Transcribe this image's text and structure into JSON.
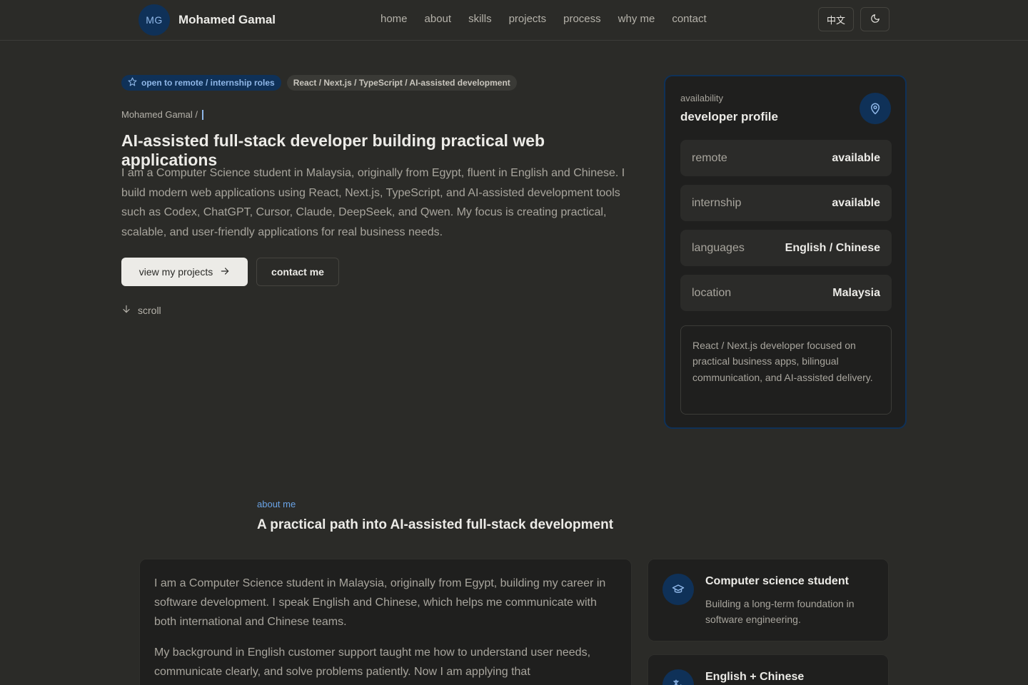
{
  "header": {
    "avatar_initials": "MG",
    "brand_name": "Mohamed Gamal",
    "nav": [
      "home",
      "about",
      "skills",
      "projects",
      "process",
      "why me",
      "contact"
    ],
    "lang_toggle": "中文",
    "theme_icon": "moon-icon"
  },
  "hero": {
    "badge_primary": "open to remote / internship roles",
    "badge_primary_icon": "star-icon",
    "badge_secondary": "React / Next.js / TypeScript / AI-assisted development",
    "breadcrumb": "Mohamed Gamal /",
    "title": "AI-assisted full-stack developer building practical web applications",
    "description": "I am a Computer Science student in Malaysia, originally from Egypt, fluent in English and Chinese. I build modern web applications using React, Next.js, TypeScript, and AI-assisted development tools such as Codex, ChatGPT, Cursor, Claude, DeepSeek, and Qwen. My focus is creating practical, scalable, and user-friendly applications for real business needs.",
    "primary_button": "view my projects",
    "secondary_button": "contact me",
    "scroll_label": "scroll"
  },
  "profile": {
    "kicker": "availability",
    "title": "developer profile",
    "icon": "map-pin-icon",
    "rows": [
      {
        "label": "remote",
        "value": "available"
      },
      {
        "label": "internship",
        "value": "available"
      },
      {
        "label": "languages",
        "value": "English / Chinese"
      },
      {
        "label": "location",
        "value": "Malaysia"
      }
    ],
    "note": "React / Next.js developer focused on practical business apps, bilingual communication, and AI-assisted delivery."
  },
  "about": {
    "kicker": "about me",
    "title": "A practical path into AI-assisted full-stack development",
    "paragraphs": [
      "I am a Computer Science student in Malaysia, originally from Egypt, building my career in software development. I speak English and Chinese, which helps me communicate with both international and Chinese teams.",
      "My background in English customer support taught me how to understand user needs, communicate clearly, and solve problems patiently. Now I am applying that"
    ],
    "features": [
      {
        "icon": "graduation-cap-icon",
        "title": "Computer science student",
        "desc": "Building a long-term foundation in software engineering."
      },
      {
        "icon": "translate-icon",
        "title": "English + Chinese",
        "desc": ""
      }
    ]
  },
  "colors": {
    "background": "#2b2b28",
    "card": "#1f1f1e",
    "accent": "#0f3158",
    "accent_text": "#8fb7e8"
  }
}
